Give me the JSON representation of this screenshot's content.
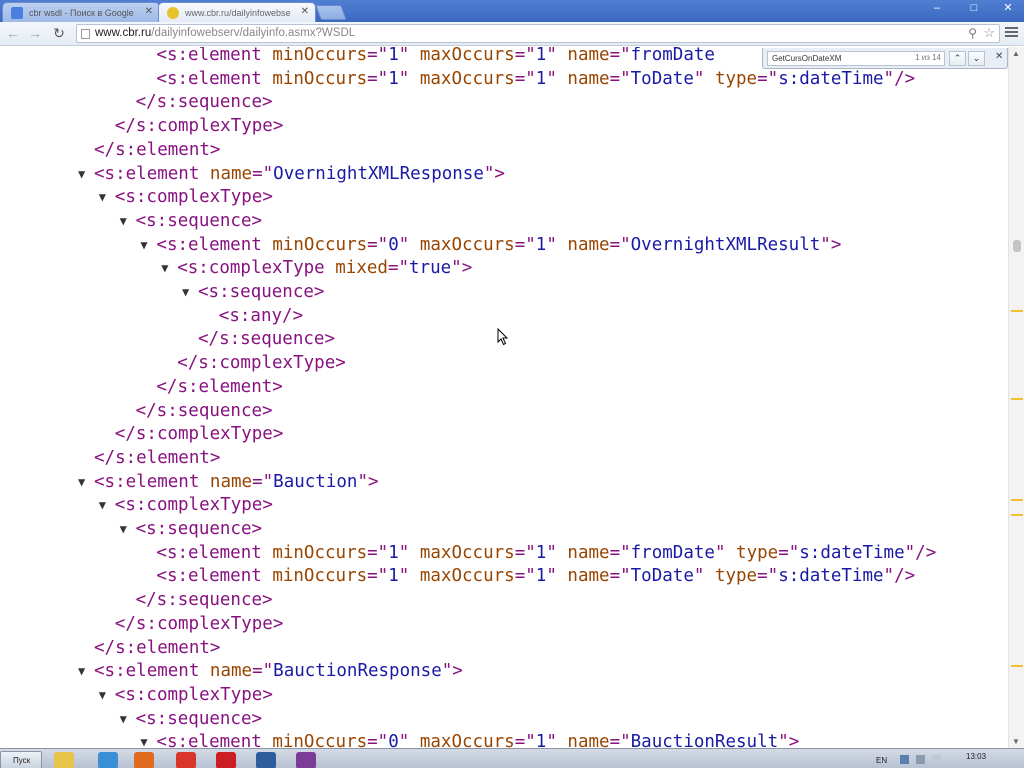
{
  "browser": {
    "tabs": [
      {
        "title": "cbr wsdl - Поиск в Google",
        "favicon": "google-icon",
        "active": false
      },
      {
        "title": "www.cbr.ru/dailyinfowebse",
        "favicon": "site-favicon-icon",
        "active": true
      }
    ],
    "url": {
      "host": "www.cbr.ru",
      "path": "/dailyinfowebserv/dailyinfo.asmx?WSDL"
    }
  },
  "find_bar": {
    "query": "GetCursOnDateXM",
    "match_count": "1 из 14"
  },
  "xml_lines": [
    {
      "indent": 3,
      "toggle": false,
      "kind": "open",
      "tag": "s:element",
      "attrs": [
        {
          "n": "minOccurs",
          "v": "1"
        },
        {
          "n": "maxOccurs",
          "v": "1"
        },
        {
          "n": "name",
          "v": "fromDate",
          "cut": true
        }
      ]
    },
    {
      "indent": 3,
      "toggle": false,
      "kind": "self",
      "tag": "s:element",
      "attrs": [
        {
          "n": "minOccurs",
          "v": "1"
        },
        {
          "n": "maxOccurs",
          "v": "1"
        },
        {
          "n": "name",
          "v": "ToDate"
        },
        {
          "n": "type",
          "v": "s:dateTime"
        }
      ]
    },
    {
      "indent": 2,
      "toggle": false,
      "kind": "close",
      "tag": "s:sequence"
    },
    {
      "indent": 1,
      "toggle": false,
      "kind": "close",
      "tag": "s:complexType"
    },
    {
      "indent": 0,
      "toggle": false,
      "kind": "close",
      "tag": "s:element"
    },
    {
      "indent": 0,
      "toggle": true,
      "kind": "open",
      "tag": "s:element",
      "attrs": [
        {
          "n": "name",
          "v": "OvernightXMLResponse"
        }
      ]
    },
    {
      "indent": 1,
      "toggle": true,
      "kind": "open",
      "tag": "s:complexType"
    },
    {
      "indent": 2,
      "toggle": true,
      "kind": "open",
      "tag": "s:sequence"
    },
    {
      "indent": 3,
      "toggle": true,
      "kind": "open",
      "tag": "s:element",
      "attrs": [
        {
          "n": "minOccurs",
          "v": "0"
        },
        {
          "n": "maxOccurs",
          "v": "1"
        },
        {
          "n": "name",
          "v": "OvernightXMLResult"
        }
      ]
    },
    {
      "indent": 4,
      "toggle": true,
      "kind": "open",
      "tag": "s:complexType",
      "attrs": [
        {
          "n": "mixed",
          "v": "true"
        }
      ]
    },
    {
      "indent": 5,
      "toggle": true,
      "kind": "open",
      "tag": "s:sequence"
    },
    {
      "indent": 6,
      "toggle": false,
      "kind": "self",
      "tag": "s:any"
    },
    {
      "indent": 5,
      "toggle": false,
      "kind": "close",
      "tag": "s:sequence"
    },
    {
      "indent": 4,
      "toggle": false,
      "kind": "close",
      "tag": "s:complexType"
    },
    {
      "indent": 3,
      "toggle": false,
      "kind": "close",
      "tag": "s:element"
    },
    {
      "indent": 2,
      "toggle": false,
      "kind": "close",
      "tag": "s:sequence"
    },
    {
      "indent": 1,
      "toggle": false,
      "kind": "close",
      "tag": "s:complexType"
    },
    {
      "indent": 0,
      "toggle": false,
      "kind": "close",
      "tag": "s:element"
    },
    {
      "indent": 0,
      "toggle": true,
      "kind": "open",
      "tag": "s:element",
      "attrs": [
        {
          "n": "name",
          "v": "Bauction"
        }
      ]
    },
    {
      "indent": 1,
      "toggle": true,
      "kind": "open",
      "tag": "s:complexType"
    },
    {
      "indent": 2,
      "toggle": true,
      "kind": "open",
      "tag": "s:sequence"
    },
    {
      "indent": 3,
      "toggle": false,
      "kind": "self",
      "tag": "s:element",
      "attrs": [
        {
          "n": "minOccurs",
          "v": "1"
        },
        {
          "n": "maxOccurs",
          "v": "1"
        },
        {
          "n": "name",
          "v": "fromDate"
        },
        {
          "n": "type",
          "v": "s:dateTime"
        }
      ]
    },
    {
      "indent": 3,
      "toggle": false,
      "kind": "self",
      "tag": "s:element",
      "attrs": [
        {
          "n": "minOccurs",
          "v": "1"
        },
        {
          "n": "maxOccurs",
          "v": "1"
        },
        {
          "n": "name",
          "v": "ToDate"
        },
        {
          "n": "type",
          "v": "s:dateTime"
        }
      ]
    },
    {
      "indent": 2,
      "toggle": false,
      "kind": "close",
      "tag": "s:sequence"
    },
    {
      "indent": 1,
      "toggle": false,
      "kind": "close",
      "tag": "s:complexType"
    },
    {
      "indent": 0,
      "toggle": false,
      "kind": "close",
      "tag": "s:element"
    },
    {
      "indent": 0,
      "toggle": true,
      "kind": "open",
      "tag": "s:element",
      "attrs": [
        {
          "n": "name",
          "v": "BauctionResponse"
        }
      ]
    },
    {
      "indent": 1,
      "toggle": true,
      "kind": "open",
      "tag": "s:complexType"
    },
    {
      "indent": 2,
      "toggle": true,
      "kind": "open",
      "tag": "s:sequence"
    },
    {
      "indent": 3,
      "toggle": true,
      "kind": "open",
      "tag": "s:element",
      "attrs": [
        {
          "n": "minOccurs",
          "v": "0"
        },
        {
          "n": "maxOccurs",
          "v": "1"
        },
        {
          "n": "name",
          "v": "BauctionResult"
        }
      ]
    }
  ],
  "taskbar": {
    "start_label": "Пуск",
    "language": "EN",
    "clock": "13:03",
    "apps": [
      {
        "name": "folder-icon",
        "color": "#e8c34a"
      },
      {
        "name": "ie-icon",
        "color": "#3a8fd6"
      },
      {
        "name": "firefox-icon",
        "color": "#e06b1f"
      },
      {
        "name": "chrome-icon",
        "color": "#d8362a"
      },
      {
        "name": "opera-icon",
        "color": "#cc1d24"
      },
      {
        "name": "app-window-icon",
        "color": "#2e5d9e"
      },
      {
        "name": "onenote-icon",
        "color": "#7b3c97"
      }
    ]
  },
  "colors": {
    "tag": "#881280",
    "attr_name": "#994500",
    "attr_value": "#1a1aa6",
    "find_highlight": "#f2c12e"
  }
}
